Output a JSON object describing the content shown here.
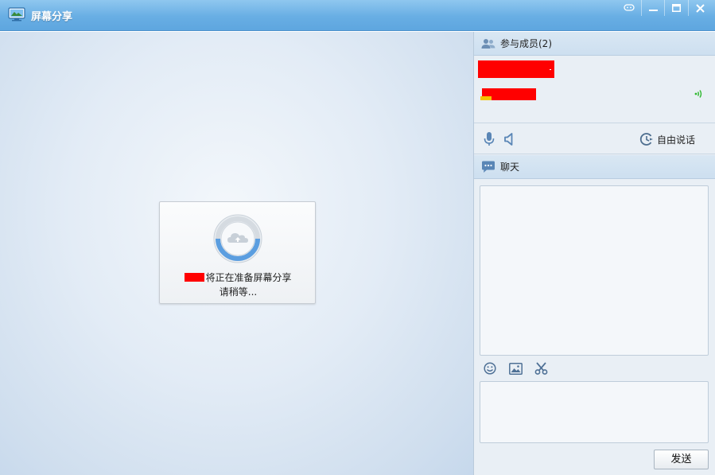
{
  "window": {
    "title": "屏幕分享",
    "controls": [
      "feedback",
      "minimize",
      "maximize",
      "close"
    ]
  },
  "share_status": {
    "line1_suffix": "将正在准备屏幕分享",
    "line2": "请稍等...",
    "progress_color": "#5b9ee0"
  },
  "members": {
    "header": "参与成员(2)"
  },
  "voice": {
    "free_talk_label": "自由说话"
  },
  "chat": {
    "header": "聊天",
    "send_label": "发送"
  },
  "colors": {
    "titlebar": "#68aee4",
    "accent": "#4d8fc9",
    "redaction": "#ff0000",
    "signal_green": "#2eb82e"
  }
}
